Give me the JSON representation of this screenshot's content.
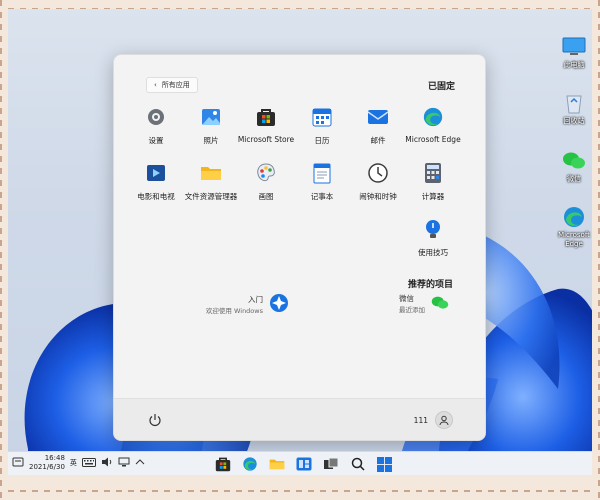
{
  "start_menu": {
    "all_apps_label": "所有应用",
    "pinned_title": "已固定",
    "pinned": [
      {
        "label": "Microsoft Edge",
        "icon": "edge-icon"
      },
      {
        "label": "邮件",
        "icon": "mail-icon"
      },
      {
        "label": "日历",
        "icon": "calendar-icon"
      },
      {
        "label": "Microsoft Store",
        "icon": "store-icon"
      },
      {
        "label": "照片",
        "icon": "photos-icon"
      },
      {
        "label": "设置",
        "icon": "settings-icon"
      },
      {
        "label": "计算器",
        "icon": "calculator-icon"
      },
      {
        "label": "闹钟和时钟",
        "icon": "clock-icon"
      },
      {
        "label": "记事本",
        "icon": "notepad-icon"
      },
      {
        "label": "画图",
        "icon": "paint-icon"
      },
      {
        "label": "文件资源管理器",
        "icon": "folder-icon"
      },
      {
        "label": "电影和电视",
        "icon": "movies-icon"
      },
      {
        "label": "使用技巧",
        "icon": "tips-icon"
      }
    ],
    "recommended_title": "推荐的项目",
    "recommended": [
      {
        "title": "微信",
        "subtitle": "最近添加",
        "icon": "wechat-icon"
      },
      {
        "title": "入门",
        "subtitle": "欢迎使用 Windows",
        "icon": "get-started-icon"
      }
    ],
    "user_name": "111"
  },
  "desktop_icons": [
    {
      "label": "此电脑",
      "icon": "computer-icon"
    },
    {
      "label": "回收站",
      "icon": "recycle-bin-icon"
    },
    {
      "label": "微信",
      "icon": "wechat-icon"
    },
    {
      "label": "Microsoft Edge",
      "icon": "edge-icon"
    }
  ],
  "taskbar": {
    "time": "16:48",
    "date": "2021/6/30",
    "ime": "英",
    "apps": [
      "start-icon",
      "search-icon",
      "task-view-icon",
      "widgets-icon",
      "file-explorer-icon",
      "edge-icon",
      "store-icon"
    ]
  },
  "colors": {
    "accent": "#0a66d8",
    "wallpaper_blue": "#1a5fe0",
    "menu_bg": "#f3f3f3"
  }
}
